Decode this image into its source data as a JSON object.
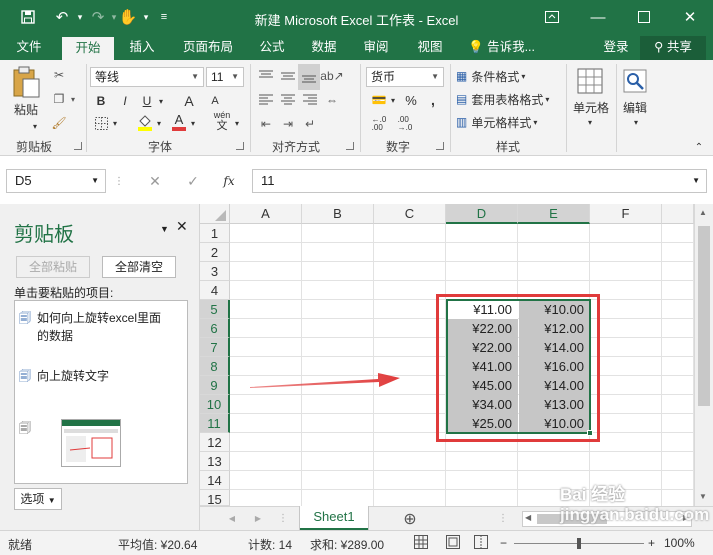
{
  "window": {
    "title": "新建 Microsoft Excel 工作表 - Excel"
  },
  "tabs": [
    "文件",
    "开始",
    "插入",
    "页面布局",
    "公式",
    "数据",
    "审阅",
    "视图"
  ],
  "tell_me": "告诉我...",
  "account": {
    "login": "登录",
    "share": "共享"
  },
  "ribbon": {
    "clipboard": {
      "paste": "粘贴",
      "label": "剪贴板"
    },
    "font": {
      "name": "等线",
      "size": "11",
      "label": "字体",
      "bold": "B",
      "italic": "I",
      "underline": "U",
      "grow": "A",
      "shrink": "A",
      "font_color_letter": "A",
      "wen": "wén"
    },
    "alignment": {
      "label": "对齐方式"
    },
    "number": {
      "format": "货币",
      "label": "数字",
      "percent": "%",
      "comma": ","
    },
    "styles": {
      "conditional": "条件格式",
      "table": "套用表格格式",
      "cell_styles": "单元格样式",
      "label": "样式"
    },
    "cells": {
      "label": "单元格"
    },
    "editing": {
      "label": "编辑"
    }
  },
  "formula_bar": {
    "namebox": "D5",
    "fx": "fx",
    "value": "11"
  },
  "clip_pane": {
    "title": "剪贴板",
    "paste_all": "全部粘贴",
    "clear_all": "全部清空",
    "instruction": "单击要粘贴的项目:",
    "items": [
      {
        "text": "如何向上旋转excel里面的数据"
      },
      {
        "text": "向上旋转文字"
      }
    ],
    "options": "选项"
  },
  "grid": {
    "columns": [
      "A",
      "B",
      "C",
      "D",
      "E",
      "F"
    ],
    "rows": [
      "1",
      "2",
      "3",
      "4",
      "5",
      "6",
      "7",
      "8",
      "9",
      "10",
      "11",
      "12",
      "13",
      "14",
      "15"
    ],
    "data_d": [
      "¥11.00",
      "¥22.00",
      "¥22.00",
      "¥41.00",
      "¥45.00",
      "¥34.00",
      "¥25.00"
    ],
    "data_e": [
      "¥10.00",
      "¥12.00",
      "¥14.00",
      "¥16.00",
      "¥14.00",
      "¥13.00",
      "¥10.00"
    ],
    "highlight_color": "#e03b3b",
    "arrow_color": "#e03b3b"
  },
  "sheet_tabs": [
    "Sheet1"
  ],
  "status": {
    "ready": "就绪",
    "average": "平均值: ¥20.64",
    "count": "计数: 14",
    "sum": "求和: ¥289.00",
    "zoom": "100%"
  },
  "watermark": "Bai 经验 jingyan.baidu.com",
  "colors": {
    "accent": "#217346"
  }
}
